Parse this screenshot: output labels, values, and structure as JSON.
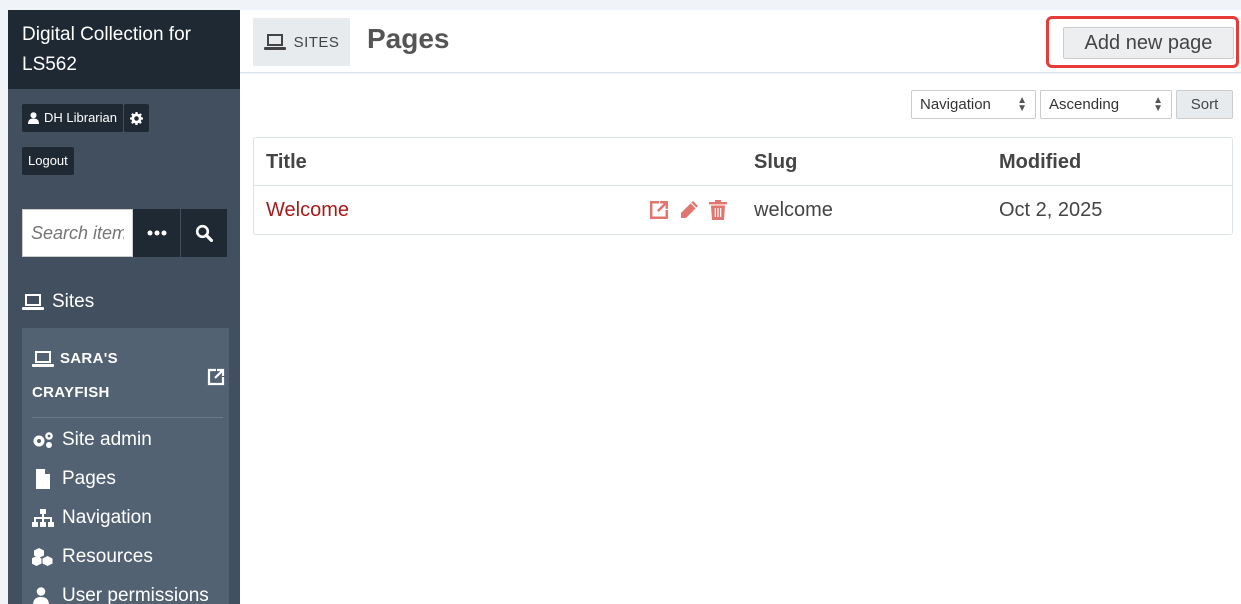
{
  "sidebar": {
    "title": "Digital Collection for LS562",
    "user_name": "DH Librarian",
    "logout_label": "Logout",
    "search": {
      "placeholder": "Search items",
      "value": ""
    },
    "sites_heading": "Sites",
    "site": {
      "name_line1": "SARA'S",
      "name_line2": "CRAYFISH",
      "nav": [
        {
          "label": "Site admin",
          "icon": "cogs-icon"
        },
        {
          "label": "Pages",
          "icon": "file-icon"
        },
        {
          "label": "Navigation",
          "icon": "sitemap-icon"
        },
        {
          "label": "Resources",
          "icon": "cubes-icon"
        },
        {
          "label": "User permissions",
          "icon": "user-icon"
        }
      ]
    }
  },
  "header": {
    "section_label": "SITES",
    "title": "Pages",
    "add_button_label": "Add new page"
  },
  "sort": {
    "field_value": "Navigation",
    "order_value": "Ascending",
    "button_label": "Sort"
  },
  "table": {
    "columns": [
      "Title",
      "Slug",
      "Modified"
    ],
    "rows": [
      {
        "title": "Welcome",
        "slug": "welcome",
        "modified": "Oct 2, 2025"
      }
    ]
  },
  "colors": {
    "sidebar_dark": "#1f2933",
    "sidebar_bg": "#424f5e",
    "link_red": "#a91919",
    "action_icon_red": "#e0766f",
    "highlight_red": "#e63b36"
  }
}
